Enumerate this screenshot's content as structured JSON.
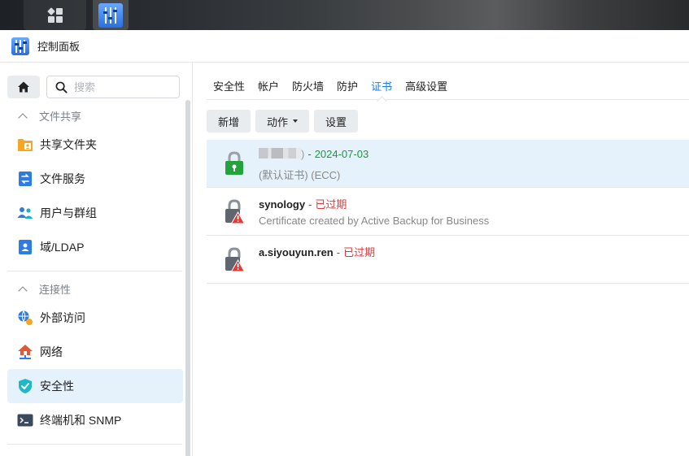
{
  "window": {
    "title": "控制面板"
  },
  "search": {
    "placeholder": "搜索"
  },
  "sidebar": {
    "groups": [
      {
        "label": "文件共享"
      },
      {
        "label": "连接性"
      }
    ],
    "items": [
      {
        "label": "共享文件夹",
        "icon": "folder-user-icon"
      },
      {
        "label": "文件服务",
        "icon": "file-transfer-icon"
      },
      {
        "label": "用户与群组",
        "icon": "users-icon"
      },
      {
        "label": "域/LDAP",
        "icon": "id-card-icon"
      },
      {
        "label": "外部访问",
        "icon": "globe-link-icon"
      },
      {
        "label": "网络",
        "icon": "network-house-icon"
      },
      {
        "label": "安全性",
        "icon": "shield-check-icon",
        "active": true
      },
      {
        "label": "终端机和 SNMP",
        "icon": "terminal-icon"
      }
    ]
  },
  "tabs": [
    {
      "label": "安全性"
    },
    {
      "label": "帐户"
    },
    {
      "label": "防火墙"
    },
    {
      "label": "防护"
    },
    {
      "label": "证书",
      "active": true
    },
    {
      "label": "高级设置"
    }
  ],
  "toolbar": {
    "add_label": "新增",
    "action_label": "动作",
    "settings_label": "设置"
  },
  "certificates": [
    {
      "name": ")",
      "separator": "-",
      "status": "2024-07-03",
      "status_color": "#1a9a3a",
      "detail": "(默认证书) (ECC)",
      "lock_state": "valid",
      "selected": true,
      "name_obscured": true
    },
    {
      "name": "synology",
      "separator": "-",
      "status": "已过期",
      "status_color": "#d83b3b",
      "detail": "Certificate created by Active Backup for Business",
      "lock_state": "expired"
    },
    {
      "name": "a.siyouyun.ren",
      "separator": "-",
      "status": "已过期",
      "status_color": "#d83b3b",
      "detail": "",
      "lock_state": "expired"
    }
  ],
  "colors": {
    "accent": "#1a7ed6",
    "valid": "#1a9a3a",
    "expired": "#d83b3b",
    "selected_bg": "#e5f1fb"
  }
}
